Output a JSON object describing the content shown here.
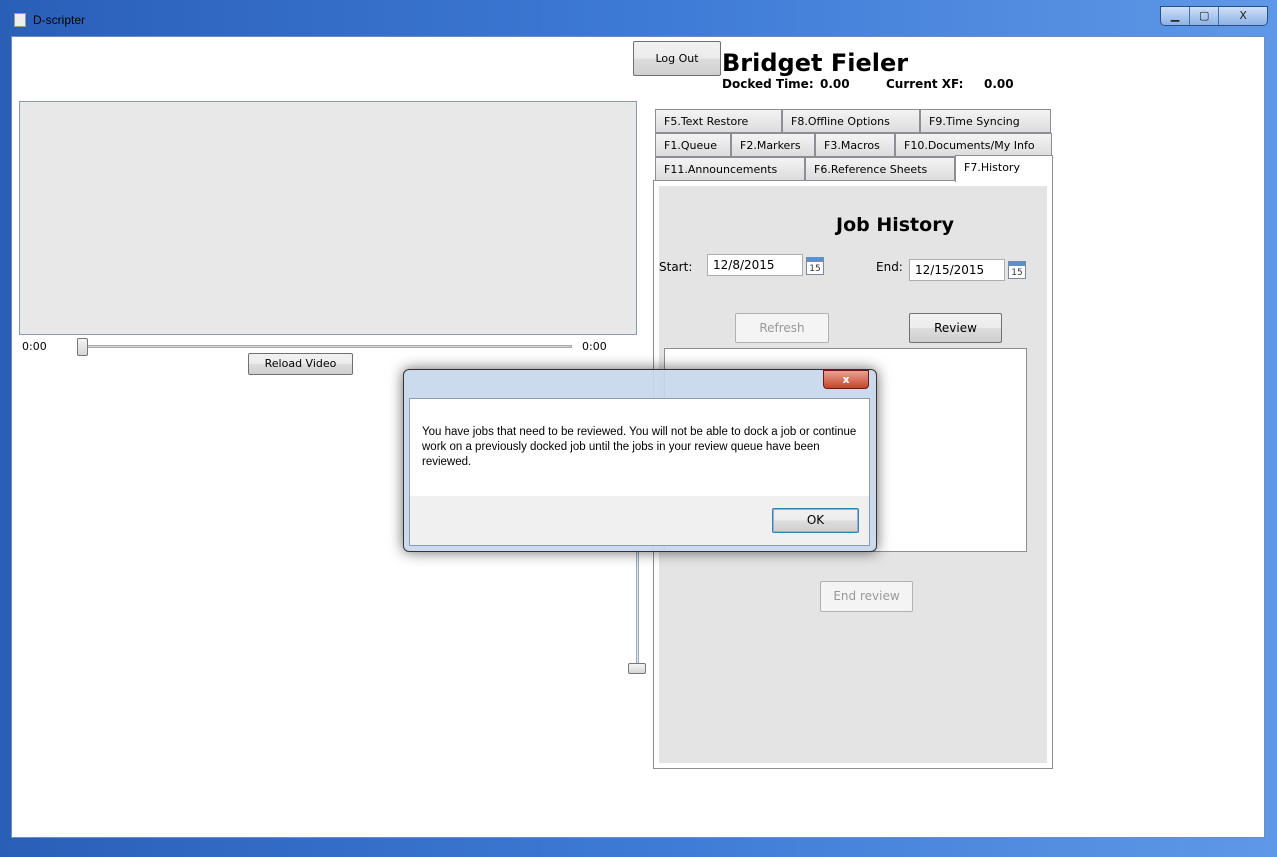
{
  "window": {
    "title": "D-scripter",
    "minimize": "▁",
    "maximize": "▢",
    "close": "X"
  },
  "header": {
    "logout": "Log Out",
    "user_name": "Bridget Fieler",
    "docked_label": "Docked Time:",
    "docked_value": "0.00",
    "xf_label": "Current XF:",
    "xf_value": "0.00"
  },
  "video": {
    "time_start": "0:00",
    "time_end": "0:00",
    "reload": "Reload Video",
    "position": 0
  },
  "tabs": {
    "row1": [
      "F5.Text Restore",
      "F8.Offline Options",
      "F9.Time Syncing"
    ],
    "row2": [
      "F1.Queue",
      "F2.Markers",
      "F3.Macros",
      "F10.Documents/My Info"
    ],
    "row3": [
      "F11.Announcements",
      "F6.Reference Sheets",
      "F7.History"
    ],
    "active": "F7.History"
  },
  "history": {
    "title": "Job History",
    "start_label": "Start:",
    "start_value": "12/8/2015",
    "end_label": "End:",
    "end_value": "12/15/2015",
    "calendar_day": "15",
    "refresh": "Refresh",
    "review": "Review",
    "end_review": "End review"
  },
  "dialog": {
    "close": "x",
    "message": "You have jobs that need to be reviewed. You will not be able to dock a job or continue work on a previously docked job until the jobs in your review queue have been reviewed.",
    "ok": "OK"
  }
}
